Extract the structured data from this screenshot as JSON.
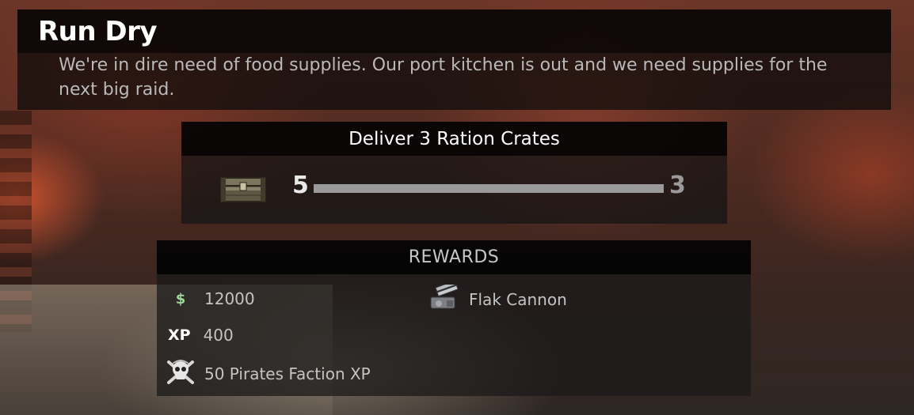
{
  "mission": {
    "title": "Run Dry",
    "description": "We're in dire need of food supplies. Our port kitchen is out and we need supplies for the next big raid."
  },
  "objective": {
    "label": "Deliver 3 Ration Crates",
    "item_icon": "ration-crate-icon",
    "progress_start": "5",
    "progress_end": "3",
    "progress_fraction": 1.0
  },
  "rewards": {
    "header": "REWARDS",
    "money": {
      "icon": "dollar-icon",
      "value": "12000",
      "color": "#9fd69c"
    },
    "xp": {
      "icon_label": "XP",
      "value": "400"
    },
    "faction": {
      "icon": "pirate-skull-icon",
      "label": "50 Pirates Faction XP"
    },
    "item": {
      "icon": "flak-cannon-icon",
      "label": "Flak Cannon"
    }
  }
}
